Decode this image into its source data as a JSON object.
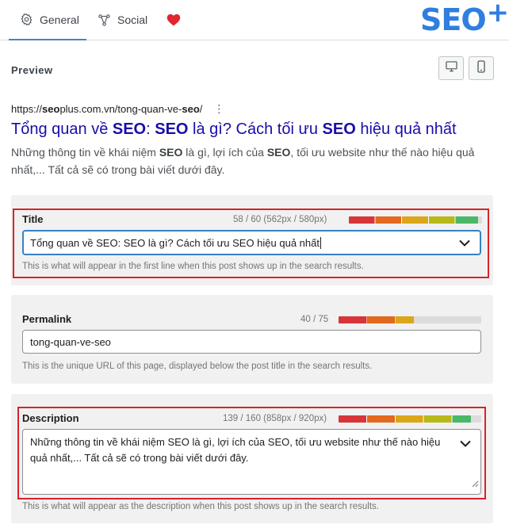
{
  "tabs": {
    "general_label": "General",
    "social_label": "Social"
  },
  "logo": {
    "text": "SEO",
    "plus": "+"
  },
  "preview": {
    "label": "Preview",
    "url_prefix": "https://",
    "url_bold": "seo",
    "url_mid": "plus.com.vn/tong-quan-ve-",
    "url_bold2": "seo",
    "url_suffix": "/",
    "title_parts": [
      "Tổng quan về ",
      "SEO",
      ": ",
      "SEO",
      " là gì? Cách tối ưu ",
      "SEO",
      " hiệu quả nhất"
    ],
    "desc_parts": [
      "Những thông tin về khái niệm ",
      "SEO",
      " là gì, lợi ích của ",
      "SEO",
      ", tối ưu website như thế nào hiệu quả nhất,... Tất cả sẽ có trong bài viết dưới đây."
    ]
  },
  "title_field": {
    "label": "Title",
    "count": "58 / 60 (562px / 580px)",
    "value": "Tổng quan về SEO: SEO là gì? Cách tối ưu SEO hiệu quả nhất",
    "hint": "This is what will appear in the first line when this post shows up in the search results.",
    "meter_fraction": 0.97
  },
  "permalink_field": {
    "label": "Permalink",
    "count": "40 / 75",
    "value": "tong-quan-ve-seo",
    "hint": "This is the unique URL of this page, displayed below the post title in the search results.",
    "meter_fraction": 0.53
  },
  "description_field": {
    "label": "Description",
    "count": "139 / 160 (858px / 920px)",
    "value": "Những thông tin về khái niệm SEO là gì, lợi ích của SEO, tối ưu website như thế nào hiệu quả nhất,... Tất cả sẽ có trong bài viết dưới đây.",
    "hint": "This is what will appear as the description when this post shows up in the search results.",
    "meter_fraction": 0.93
  },
  "colors": {
    "accent": "#3582c4",
    "highlight_frame": "#d8222a",
    "link": "#1a0dab",
    "logo": "#2f7ee0",
    "heart": "#e0262f",
    "meter_gradient": [
      "#d63638",
      "#e2691f",
      "#dba617",
      "#b8b81a",
      "#4ab866"
    ]
  },
  "icons": {
    "general": "gear-icon",
    "social": "share-nodes-icon",
    "favorite": "heart-icon",
    "desktop": "desktop-icon",
    "mobile": "mobile-icon",
    "more": "vertical-dots-icon",
    "dropdown": "chevron-down-icon"
  }
}
